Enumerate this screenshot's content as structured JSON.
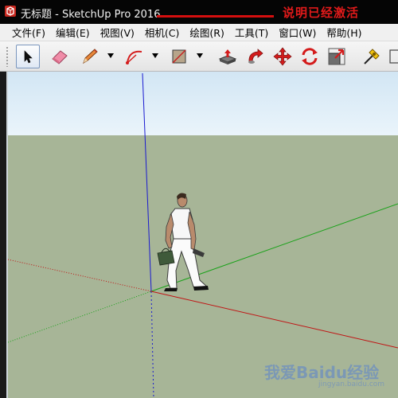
{
  "window": {
    "title": "无标题 - SketchUp Pro 2016",
    "note": "说明已经激活"
  },
  "menu": {
    "items": [
      "文件(F)",
      "编辑(E)",
      "视图(V)",
      "相机(C)",
      "绘图(R)",
      "工具(T)",
      "窗口(W)",
      "帮助(H)"
    ]
  },
  "toolbar": {
    "tools": [
      "select-icon",
      "eraser-icon",
      "pencil-icon",
      "arc-icon",
      "rectangle-icon",
      "push-pull-icon",
      "follow-me-icon",
      "move-icon",
      "rotate-icon",
      "scale-icon",
      "tape-measure-icon"
    ]
  },
  "colors": {
    "sky_top": "#d2e6f4",
    "ground": "#a7b597",
    "axis_red": "#c01515",
    "axis_green": "#1aa21a",
    "axis_blue": "#1a1ad0"
  },
  "watermark": {
    "text": "我爱Baidu经验",
    "sub": "jingyan.baidu.com"
  }
}
